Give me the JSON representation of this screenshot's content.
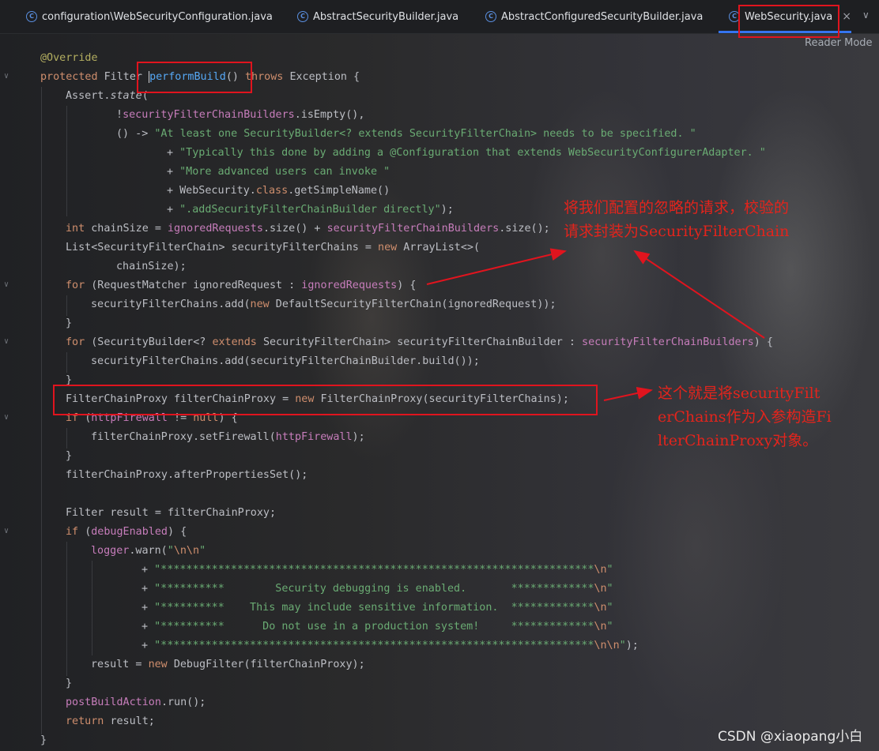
{
  "tabs": [
    {
      "label": "configuration\\WebSecurityConfiguration.java",
      "icon": "java-class-icon"
    },
    {
      "label": "AbstractSecurityBuilder.java",
      "icon": "java-class-icon"
    },
    {
      "label": "AbstractConfiguredSecurityBuilder.java",
      "icon": "java-class-icon"
    },
    {
      "label": "WebSecurity.java",
      "icon": "java-class-icon",
      "active": true
    }
  ],
  "tab_close": "×",
  "tab_menu": "∨",
  "reader_mode": "Reader Mode",
  "code": {
    "l1": "@Override",
    "l2a": "protected ",
    "l2b": "Filter ",
    "l2c": "performBuild",
    "l2d": "() ",
    "l2e": "throws ",
    "l2f": "Exception {",
    "l3a": "Assert.",
    "l3b": "state",
    "l3c": "(",
    "l4a": "!",
    "l4b": "securityFilterChainBuilders",
    "l4c": ".isEmpty(),",
    "l5a": "() -> ",
    "l5b": "\"At least one SecurityBuilder<? extends SecurityFilterChain> needs to be specified. \"",
    "l6a": "+ ",
    "l6b": "\"Typically this done by adding a @Configuration that extends WebSecurityConfigurerAdapter. \"",
    "l7a": "+ ",
    "l7b": "\"More advanced users can invoke \"",
    "l8a": "+ WebSecurity.",
    "l8b": "class",
    "l8c": ".getSimpleName()",
    "l9a": "+ ",
    "l9b": "\".addSecurityFilterChainBuilder directly\"",
    "l9c": ");",
    "l10a": "int ",
    "l10b": "chainSize = ",
    "l10c": "ignoredRequests",
    "l10d": ".size() + ",
    "l10e": "securityFilterChainBuilders",
    "l10f": ".size();",
    "l11a": "List<SecurityFilterChain> securityFilterChains = ",
    "l11b": "new ",
    "l11c": "ArrayList<>(",
    "l12": "chainSize);",
    "l13a": "for ",
    "l13b": "(RequestMatcher ignoredRequest : ",
    "l13c": "ignoredRequests",
    "l13d": ") {",
    "l14a": "securityFilterChains.add(",
    "l14b": "new ",
    "l14c": "DefaultSecurityFilterChain(ignoredRequest));",
    "l15": "}",
    "l16a": "for ",
    "l16b": "(SecurityBuilder<? ",
    "l16c": "extends ",
    "l16d": "SecurityFilterChain> securityFilterChainBuilder : ",
    "l16e": "securityFilterChainBuilders",
    "l16f": ") {",
    "l17": "securityFilterChains.add(securityFilterChainBuilder.build());",
    "l18": "}",
    "l19a": "FilterChainProxy filterChainProxy = ",
    "l19b": "new ",
    "l19c": "FilterChainProxy(securityFilterChains);",
    "l20a": "if ",
    "l20b": "(",
    "l20c": "httpFirewall",
    "l20d": " != ",
    "l20e": "null",
    "l20f": ") {",
    "l21a": "filterChainProxy.setFirewall(",
    "l21b": "httpFirewall",
    "l21c": ");",
    "l22": "}",
    "l23": "filterChainProxy.afterPropertiesSet();",
    "l25": "Filter result = filterChainProxy;",
    "l26a": "if ",
    "l26b": "(",
    "l26c": "debugEnabled",
    "l26d": ") {",
    "l27a": "logger",
    "l27b": ".warn(",
    "l27c": "\"",
    "l27d": "\\n\\n",
    "l27e": "\"",
    "l28a": "+ ",
    "l28b": "\"********************************************************************",
    "l28c": "\\n",
    "l28d": "\"",
    "l29a": "+ ",
    "l29b": "\"**********        Security debugging is enabled.       *************",
    "l29c": "\\n",
    "l29d": "\"",
    "l30a": "+ ",
    "l30b": "\"**********    This may include sensitive information.  *************",
    "l30c": "\\n",
    "l30d": "\"",
    "l31a": "+ ",
    "l31b": "\"**********      Do not use in a production system!     *************",
    "l31c": "\\n",
    "l31d": "\"",
    "l32a": "+ ",
    "l32b": "\"********************************************************************",
    "l32c": "\\n\\n",
    "l32d": "\"",
    "l32e": ");",
    "l33a": "result = ",
    "l33b": "new ",
    "l33c": "DebugFilter(filterChainProxy);",
    "l34": "}",
    "l35a": "postBuildAction",
    "l35b": ".run();",
    "l36a": "return ",
    "l36b": "result;",
    "l37": "}"
  },
  "annotations": {
    "note1_line1": "将我们配置的忽略的请求，校验的",
    "note1_line2": "请求封装为SecurityFilterChain",
    "note2_line1": "这个就是将securityFilt",
    "note2_line2": "erChains作为入参构造Fi",
    "note2_line3": "lterChainProxy对象。",
    "color": "#e3241c"
  },
  "watermark": "CSDN @xiaopang小白"
}
